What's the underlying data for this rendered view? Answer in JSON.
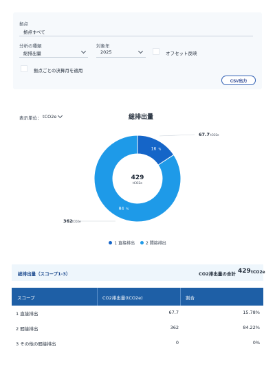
{
  "filters": {
    "base_label": "拠点",
    "base_value": "拠点すべて",
    "analysis_label": "分析の種類",
    "analysis_value": "総排出量",
    "year_label": "対象年",
    "year_value": "2025",
    "offset_label": "オフセット反映",
    "fiscal_label": "拠点ごとの決算月を適用",
    "csv_button": "CSV出力"
  },
  "display": {
    "unit_label": "表示単位：",
    "unit_value": "tCO2e",
    "chart_title": "総排出量"
  },
  "chart_data": {
    "type": "pie",
    "title": "総排出量",
    "center_value": "429",
    "center_unit": "tCO2e",
    "categories": [
      "1 直接排出",
      "2 間接排出"
    ],
    "values": [
      67.7,
      362
    ],
    "percent_labels": [
      "16",
      "84"
    ],
    "outer_labels": [
      {
        "value": "67.7",
        "unit": "tCO2e"
      },
      {
        "value": "362",
        "unit": "tCO2e"
      }
    ],
    "colors": [
      "#1565c8",
      "#1e9ae8"
    ]
  },
  "legend": [
    {
      "label": "1 直接排出",
      "color": "#1565c8"
    },
    {
      "label": "2 間接排出",
      "color": "#1e9ae8"
    }
  ],
  "summary": {
    "title": "総排出量（スコープ1-3）",
    "total_label": "CO2排出量の合計",
    "total_value": "429",
    "total_unit": "tCO2e"
  },
  "table": {
    "headers": [
      "スコープ",
      "CO2排出量(tCO2e)",
      "割合"
    ],
    "rows": [
      {
        "scope": "1 直接排出",
        "amount": "67.7",
        "ratio": "15.78%"
      },
      {
        "scope": "2 間接排出",
        "amount": "362",
        "ratio": "84.22%"
      },
      {
        "scope": "3 その他の間接排出",
        "amount": "0",
        "ratio": "0%"
      }
    ]
  }
}
